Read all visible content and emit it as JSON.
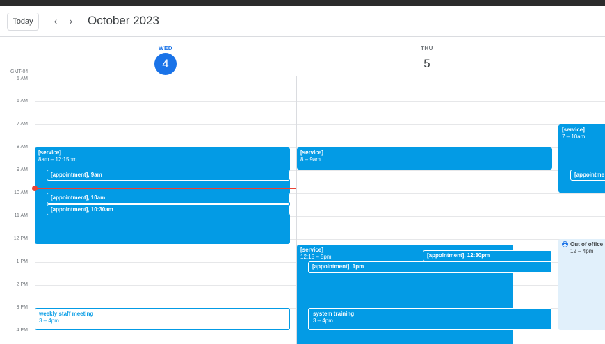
{
  "header": {
    "today_label": "Today",
    "prev_icon": "‹",
    "next_icon": "›",
    "month_title": "October 2023"
  },
  "timezone": "GMT-04",
  "days": [
    {
      "dow": "WED",
      "num": "4"
    },
    {
      "dow": "THU",
      "num": "5"
    }
  ],
  "hours": [
    "5 AM",
    "6 AM",
    "7 AM",
    "8 AM",
    "9 AM",
    "10 AM",
    "11 AM",
    "12 PM",
    "1 PM",
    "2 PM",
    "3 PM",
    "4 PM"
  ],
  "events": {
    "wed_service": {
      "title": "[service]",
      "time": "8am – 12:15pm"
    },
    "wed_appt_9": {
      "title": "[appointment], 9am"
    },
    "wed_appt_10": {
      "title": "[appointment], 10am"
    },
    "wed_appt_1030": {
      "title": "[appointment], 10:30am"
    },
    "wed_staff": {
      "title": "weekly staff meeting",
      "time": "3 – 4pm"
    },
    "thu_service_am": {
      "title": "[service]",
      "time": "8 – 9am"
    },
    "thu_service_pm": {
      "title": "[service]",
      "time": "12:15 – 5pm"
    },
    "thu_appt_1230": {
      "title": "[appointment], 12:30pm"
    },
    "thu_appt_1": {
      "title": "[appointment], 1pm"
    },
    "thu_training": {
      "title": "system training",
      "time": "3 – 4pm"
    },
    "fri_service": {
      "title": "[service]",
      "time": "7 – 10am"
    },
    "fri_appt": {
      "title": "[appointme"
    },
    "fri_ooo": {
      "title": "Out of office",
      "time": "12 – 4pm"
    }
  },
  "colors": {
    "event": "#039be5",
    "today": "#1a73e8",
    "now": "#ea4335",
    "ooo_bg": "#e1f0fb"
  }
}
